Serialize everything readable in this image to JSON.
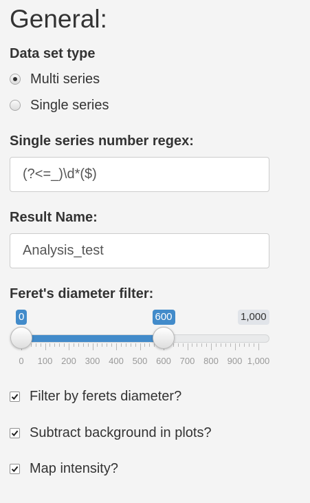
{
  "heading": "General:",
  "dataset": {
    "label": "Data set type",
    "options": [
      {
        "label": "Multi series",
        "checked": true
      },
      {
        "label": "Single series",
        "checked": false
      }
    ]
  },
  "regex": {
    "label": "Single series number regex:",
    "value": "(?<=_)\\d*($)"
  },
  "result": {
    "label": "Result Name:",
    "value": "Analysis_test"
  },
  "slider": {
    "label": "Feret's diameter filter:",
    "min": 0,
    "max": 1000,
    "from": 0,
    "to": 600,
    "from_label": "0",
    "to_label": "600",
    "max_label": "1,000",
    "accent_color": "#428bca",
    "ticks": [
      "0",
      "100",
      "200",
      "300",
      "400",
      "500",
      "600",
      "700",
      "800",
      "900",
      "1,000"
    ]
  },
  "checkboxes": [
    {
      "label": "Filter by ferets diameter?",
      "checked": true
    },
    {
      "label": "Subtract background in plots?",
      "checked": true
    },
    {
      "label": "Map intensity?",
      "checked": true
    }
  ]
}
